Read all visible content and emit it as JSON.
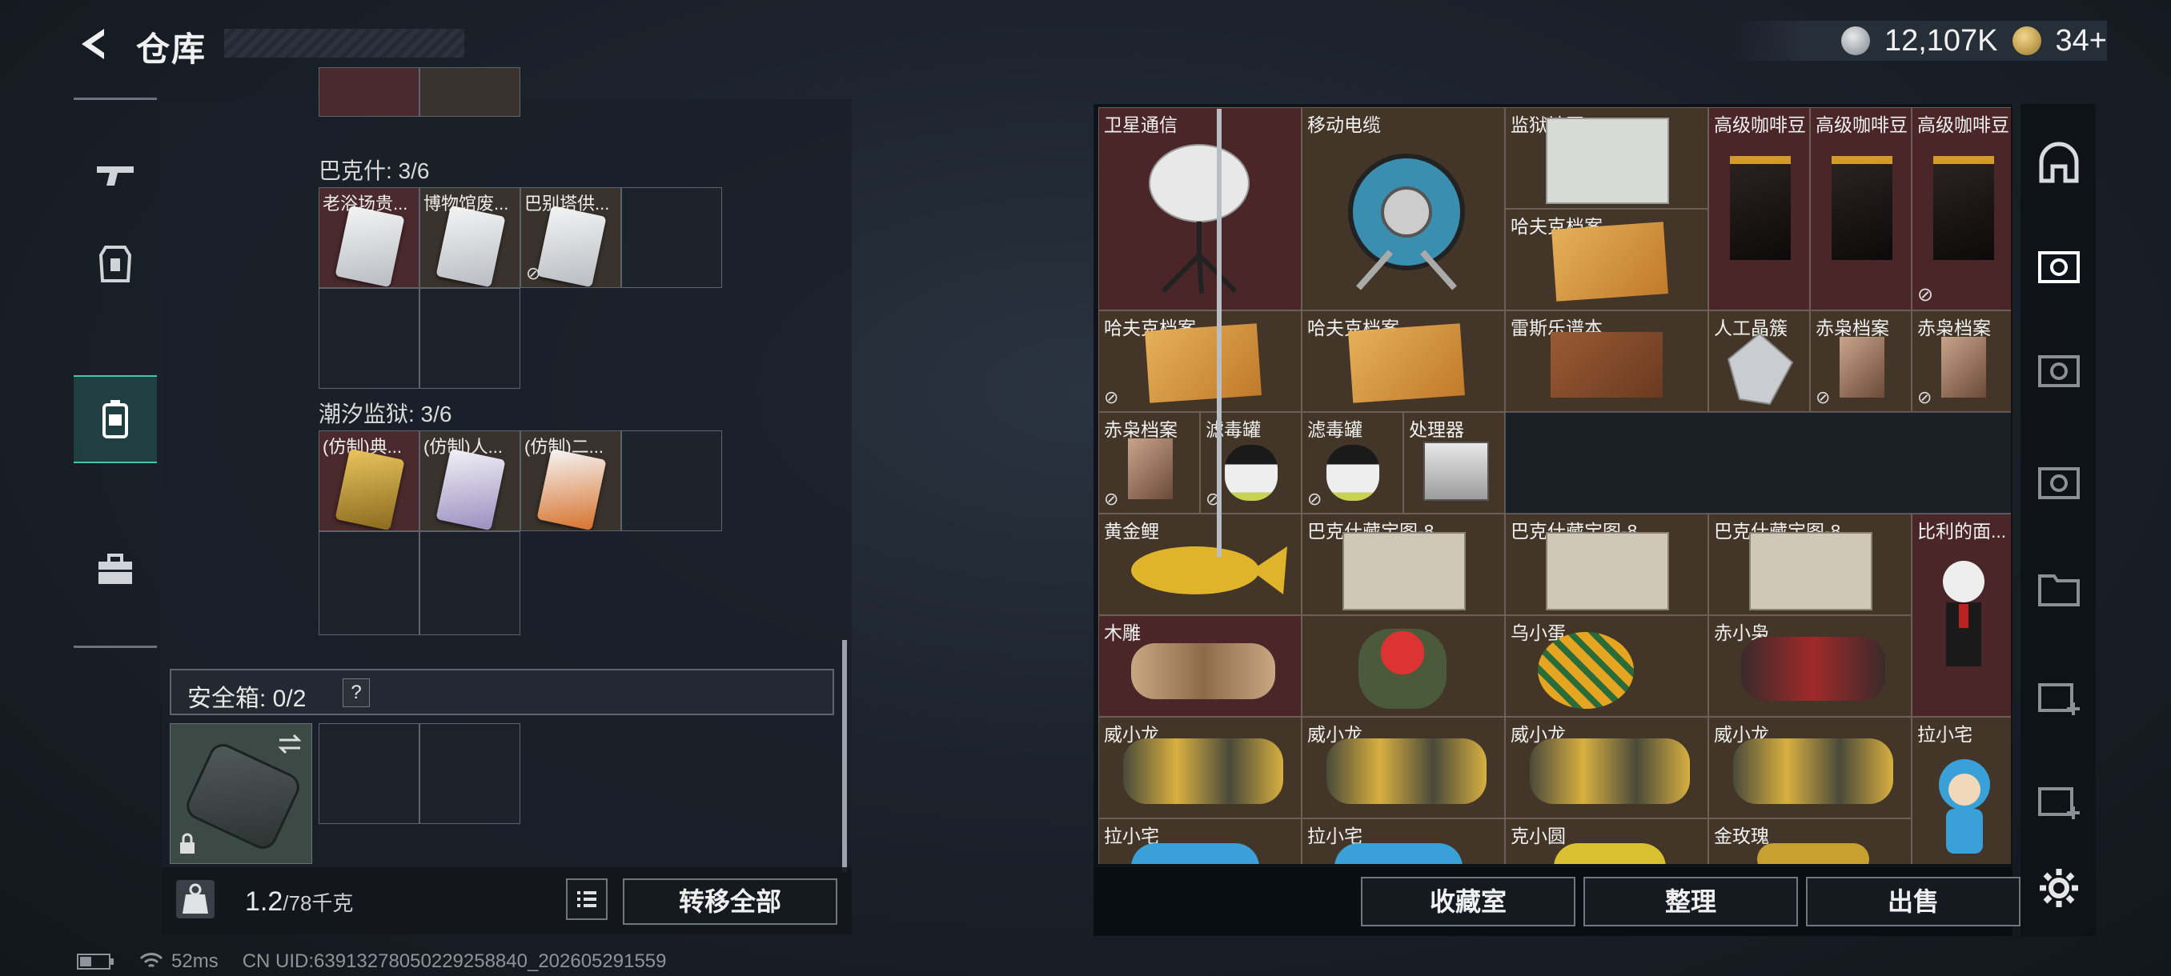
{
  "header": {
    "title": "仓库",
    "coins": "12,107K",
    "tokens": "34+"
  },
  "left": {
    "sections": [
      {
        "label": "巴克什: 3/6",
        "items": [
          "老浴场贵...",
          "博物馆废...",
          "巴别塔供..."
        ]
      },
      {
        "label": "潮汐监狱: 3/6",
        "items": [
          "(仿制)典...",
          "(仿制)人...",
          "(仿制)二..."
        ]
      }
    ],
    "safe_box": {
      "label": "安全箱:  0/2",
      "help": "?"
    },
    "weight": {
      "value": "1.2",
      "max": "/78千克"
    },
    "transfer_all": "转移全部"
  },
  "right": {
    "items": [
      "卫星通信",
      "移动电缆",
      "监狱地图1",
      "高级咖啡豆",
      "高级咖啡豆",
      "高级咖啡豆",
      "哈夫克档案",
      "哈夫克档案",
      "哈夫克档案",
      "雷斯乐谱本",
      "人工晶簇",
      "赤枭档案",
      "赤枭档案",
      "赤枭档案",
      "滤毒罐",
      "滤毒罐",
      "处理器",
      "黄金鲤",
      "巴克什藏宝图-8",
      "巴克什藏宝图-8",
      "巴克什藏宝图-8",
      "比利的面...",
      "木雕",
      "",
      "乌小蛋",
      "赤小枭",
      "威小龙",
      "威小龙",
      "威小龙",
      "威小龙",
      "拉小宅",
      "拉小宅",
      "拉小宅",
      "克小圆",
      "金玫瑰"
    ],
    "buttons": {
      "collection": "收藏室",
      "sort": "整理",
      "sell": "出售"
    }
  },
  "status": {
    "ping": "52ms",
    "uid": "CN UID:63913278050229258840_202605291559"
  },
  "colors": {
    "accent": "#45c7a8",
    "red_cell": "#4a2628",
    "brown_cell": "#433628"
  },
  "icons": [
    "back-arrow-icon",
    "coin-icon",
    "token-icon",
    "gun-icon",
    "armor-icon",
    "backpack-icon",
    "toolbox-icon",
    "lock-icon",
    "swap-icon",
    "weight-icon",
    "list-icon",
    "helmet-icon",
    "safe-icon",
    "gear-icon"
  ]
}
